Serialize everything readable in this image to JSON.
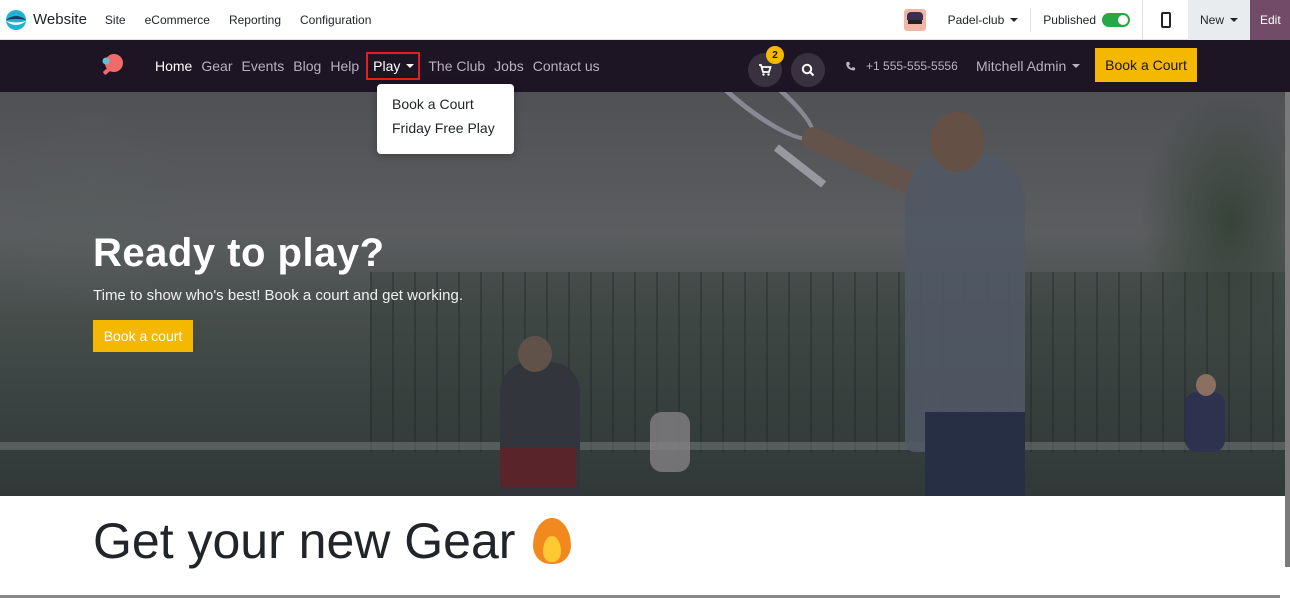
{
  "admin_bar": {
    "app_name": "Website",
    "menus": [
      "Site",
      "eCommerce",
      "Reporting",
      "Configuration"
    ],
    "website_selector": "Padel-club",
    "published_label": "Published",
    "published": true,
    "new_label": "New",
    "edit_label": "Edit"
  },
  "site_header": {
    "nav": [
      "Home",
      "Gear",
      "Events",
      "Blog",
      "Help"
    ],
    "play_label": "Play",
    "nav_after": [
      "The Club",
      "Jobs",
      "Contact us"
    ],
    "cart_count": "2",
    "phone": "+1 555-555-5556",
    "user": "Mitchell Admin",
    "cta": "Book a Court"
  },
  "play_dropdown": {
    "items": [
      "Book a Court",
      "Friday Free Play"
    ]
  },
  "hero": {
    "title": "Ready to play?",
    "subtitle": "Time to show who's best! Book a court and get working.",
    "button": "Book a court"
  },
  "section": {
    "heading": "Get your new Gear"
  },
  "colors": {
    "header_bg": "#1d1424",
    "accent_yellow": "#f5b800",
    "edit_purple": "#714b67",
    "highlight_red": "#e02020"
  }
}
